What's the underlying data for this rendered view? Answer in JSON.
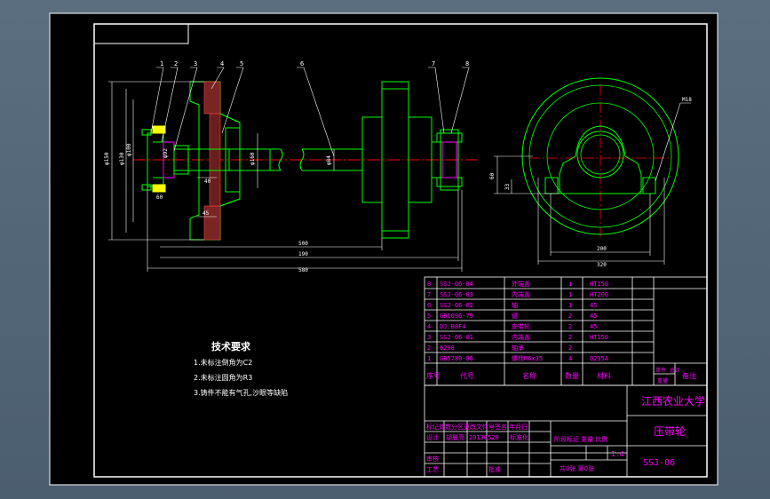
{
  "colors": {
    "viewport_bg": "#51667a",
    "sheet_bg": "#000000",
    "frame": "#ffffff",
    "part_green": "#00ff00",
    "dimension_white": "#ffffff",
    "center_red": "#ff0000",
    "table_magenta": "#ff00ff",
    "callout": "#ffffff"
  },
  "callouts": [
    "1",
    "2",
    "3",
    "4",
    "5",
    "6",
    "7",
    "8"
  ],
  "dims": {
    "d150": "φ150",
    "d130": "φ130",
    "d100": "φ100",
    "d92": "φ92",
    "d160": "φ160",
    "d84": "φ84",
    "l40": "40",
    "l45": "45",
    "l60": "60",
    "l500": "500",
    "l190": "190",
    "l580": "580",
    "r60": "60",
    "r33": "33",
    "w200": "200",
    "w320": "320",
    "m18": "M18"
  },
  "tech": {
    "title": "技术要求",
    "items": [
      "1.未标注倒角为C2",
      "2.未标注圆角为R3",
      "3.铸件不能有气孔,沙眼等缺陷"
    ]
  },
  "bom": {
    "rows": [
      {
        "no": "8",
        "code": "SSJ-06-04",
        "name": "外端盖",
        "qty": "1",
        "material": "HT150"
      },
      {
        "no": "7",
        "code": "SSJ-06-03",
        "name": "内端盖",
        "qty": "1",
        "material": "HT200"
      },
      {
        "no": "6",
        "code": "SSJ-06-02",
        "name": "轴",
        "qty": "1",
        "material": "45"
      },
      {
        "no": "5",
        "code": "GB1096-79",
        "name": "键",
        "qty": "2",
        "material": "45"
      },
      {
        "no": "4",
        "code": "DJ.B8F4",
        "name": "皮带轮",
        "qty": "2",
        "material": "45"
      },
      {
        "no": "3",
        "code": "SSJ-06-01",
        "name": "内端盖",
        "qty": "2",
        "material": "HT150"
      },
      {
        "no": "2",
        "code": "6208",
        "name": "轴承",
        "qty": "2",
        "material": ""
      },
      {
        "no": "1",
        "code": "GB5780-86",
        "name": "螺栓M6x35",
        "qty": "4",
        "material": "Q235A"
      }
    ],
    "header": {
      "no": "序号",
      "code": "代号",
      "name": "名称",
      "qty": "数量",
      "material": "材料",
      "weight": "单件 总计",
      "weight2": "重量",
      "remark": "备注"
    }
  },
  "title_block": {
    "school": "江西农业大学",
    "part_name": "压带轮",
    "drawing_no": "SSJ-06",
    "scale": "1:4",
    "revision_row": "标记处数分区更改文件号签名 年月日",
    "design_row": "设计",
    "designer": "胡晨亮",
    "date_code": "20130520",
    "standard": "标准化",
    "stage_labels": "阶段标记 重量 比例",
    "review": "审核",
    "process": "工艺",
    "approve": "批准",
    "sheets": "共0张 第0张"
  }
}
